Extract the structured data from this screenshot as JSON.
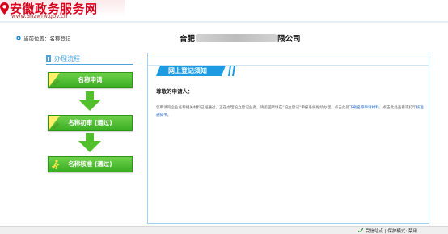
{
  "header": {
    "site_title": "安徽政务服务网",
    "site_url": "www.ahzwfw.gov.cn",
    "brand_color": "#d6001c"
  },
  "breadcrumb": {
    "label": "当前位置：",
    "current": "名称登记"
  },
  "company": {
    "prefix": "合肥",
    "suffix": "限公司"
  },
  "process": {
    "title": "办理流程",
    "steps": [
      {
        "tag": "完成",
        "label": "名称申请"
      },
      {
        "tag": "完成",
        "label": "名称初审 (通过)"
      },
      {
        "tag": "",
        "label": "名称核准 (通过)"
      }
    ],
    "step_color": "#3aae22"
  },
  "notice": {
    "title": "网上登记须知",
    "greeting": "尊敬的申请人：",
    "body_prefix": "您申请的企业名称相关材料已经通过，正在办理设立登记业务，请追回所填在“设立登记”申报系统继续办理。点击此处",
    "link1": "下载名称申请材料",
    "body_middle": "，点击此处查看或打印",
    "link2": "核准通知书",
    "body_end": "。",
    "accent_color": "#1d9be2"
  },
  "statusbar": {
    "text": "受信站点 | 保护模式: 禁用"
  }
}
